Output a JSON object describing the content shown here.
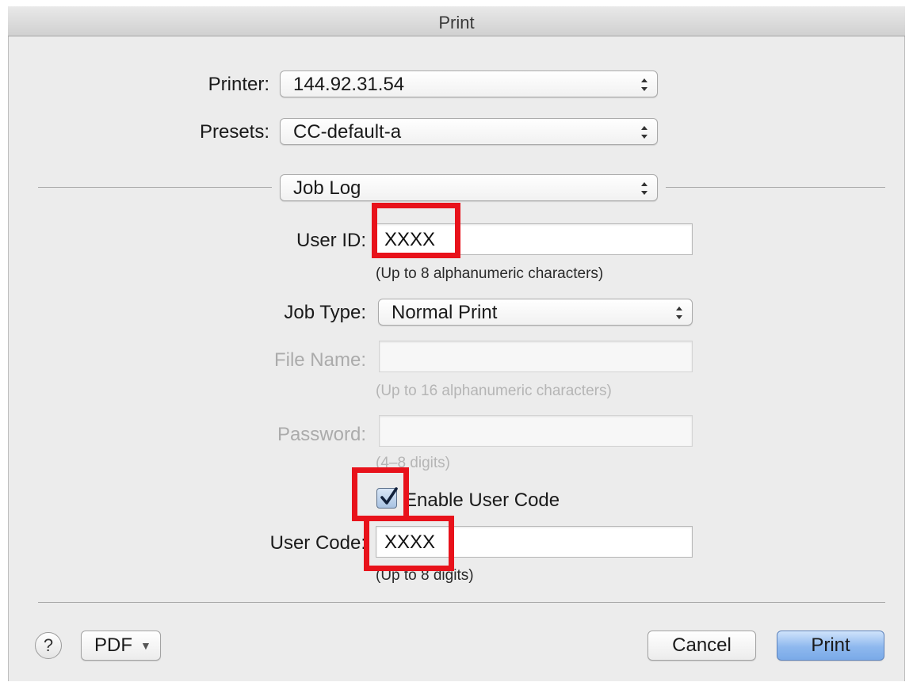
{
  "window": {
    "title": "Print"
  },
  "printer": {
    "label": "Printer:",
    "value": "144.92.31.54"
  },
  "presets": {
    "label": "Presets:",
    "value": "CC-default-a"
  },
  "panel_select": {
    "value": "Job Log"
  },
  "user_id": {
    "label": "User ID:",
    "value": "XXXX",
    "hint": "(Up to 8 alphanumeric characters)"
  },
  "job_type": {
    "label": "Job Type:",
    "value": "Normal Print"
  },
  "file_name": {
    "label": "File Name:",
    "value": "",
    "hint": "(Up to 16 alphanumeric characters)",
    "disabled": true
  },
  "password": {
    "label": "Password:",
    "value": "",
    "hint": "(4–8 digits)",
    "disabled": true
  },
  "enable_user_code": {
    "label": "Enable User Code",
    "checked": true
  },
  "user_code": {
    "label": "User Code:",
    "value": "XXXX",
    "hint": "(Up to 8 digits)"
  },
  "footer": {
    "help_symbol": "?",
    "pdf_label": "PDF",
    "pdf_caret": "▼",
    "cancel_label": "Cancel",
    "print_label": "Print"
  },
  "annotation": {
    "highlight_color": "#e8121b"
  }
}
